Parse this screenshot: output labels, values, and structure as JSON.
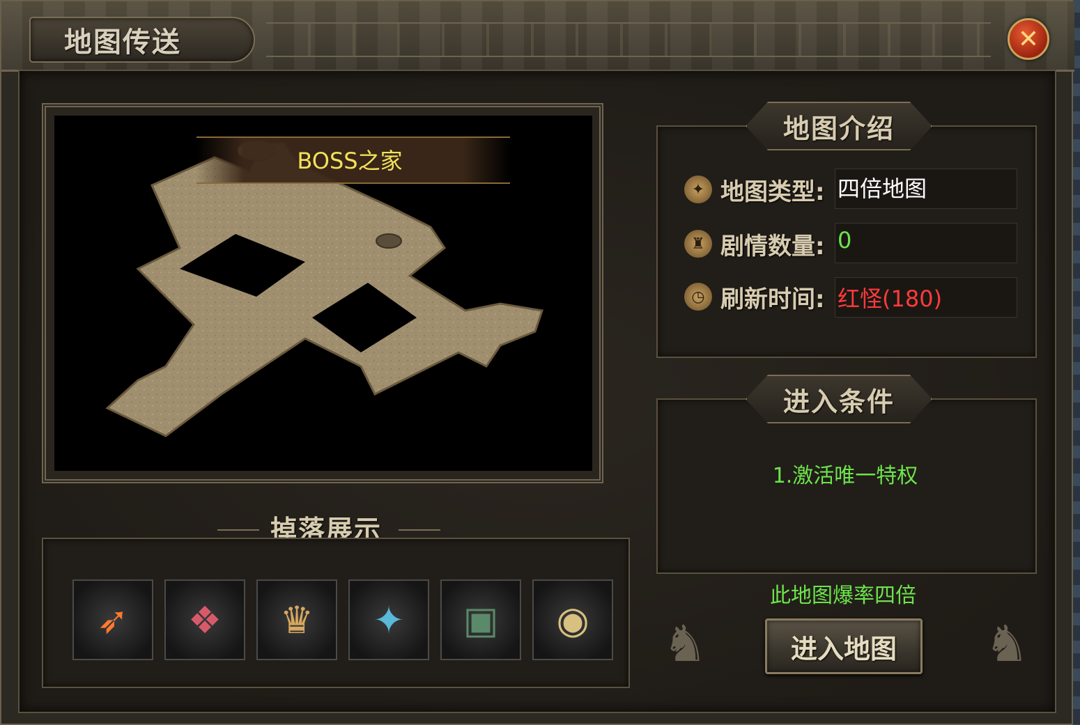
{
  "window": {
    "title": "地图传送",
    "close_icon": "close-icon"
  },
  "map_preview": {
    "map_name": "BOSS之家"
  },
  "drops": {
    "title": "掉落展示",
    "items": [
      {
        "icon": "feather-icon"
      },
      {
        "icon": "gift-pack-icon"
      },
      {
        "icon": "scroll-icon"
      },
      {
        "icon": "skill-book-icon"
      },
      {
        "icon": "treasure-chest-icon"
      },
      {
        "icon": "food-dish-icon"
      }
    ]
  },
  "map_intro": {
    "title": "地图介绍",
    "rows": [
      {
        "label": "地图类型:",
        "value": "四倍地图",
        "value_color": "#ffffff",
        "icon": "compass-icon"
      },
      {
        "label": "剧情数量:",
        "value": "0",
        "value_color": "#6de44c",
        "icon": "scroll-seal-icon"
      },
      {
        "label": "刷新时间:",
        "value": "红怪(180)",
        "value_color": "#ff3b3b",
        "icon": "clock-icon"
      }
    ]
  },
  "entry_conditions": {
    "title": "进入条件",
    "conditions": "1.激活唯一特权"
  },
  "drop_rate_note": "此地图爆率四倍",
  "enter_button": "进入地图",
  "colors": {
    "accent_gold": "#c9a45a",
    "green_text": "#6de44c",
    "red_text": "#ff3b3b",
    "map_name_yellow": "#f2e25a"
  }
}
